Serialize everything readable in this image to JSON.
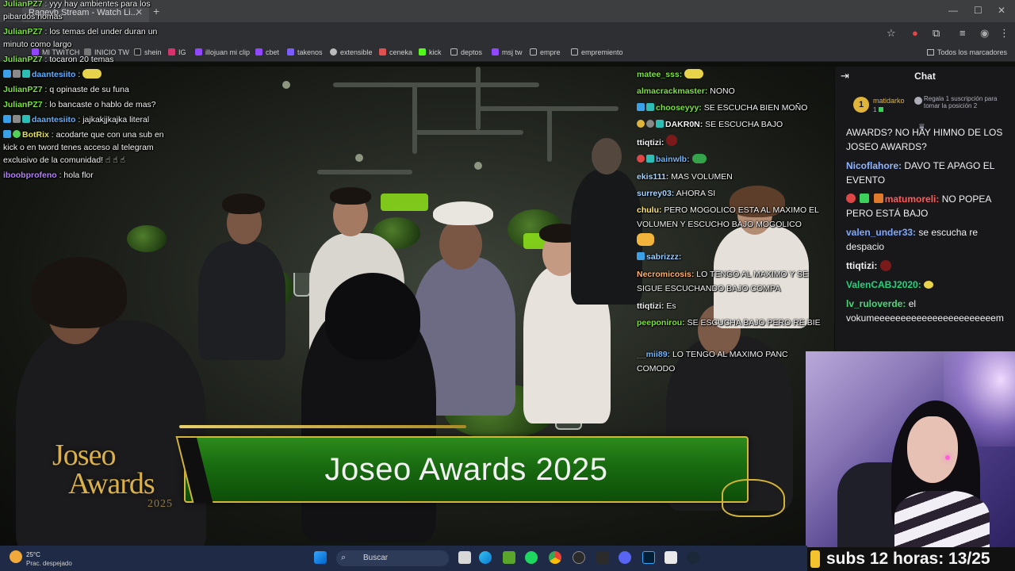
{
  "browser": {
    "tab_title": "Rageyb Stream - Watch Li...",
    "bookmarks": [
      "MI TWITCH",
      "INICIO TW",
      "shein",
      "IG",
      "illojuan mi clip",
      "cbet",
      "takenos",
      "extensible",
      "ceneka",
      "kick",
      "deptos",
      "msj tw",
      "empre",
      "empremiento"
    ],
    "all_bookmarks": "Todos los marcadores"
  },
  "stream": {
    "logo_line1": "Joseo",
    "logo_line2": "Awards",
    "logo_year": "2025",
    "banner_title": "Joseo Awards 2025"
  },
  "overlay_left": [
    {
      "user": "JulianPZ7",
      "text": ": yyy hay ambientes para los"
    },
    {
      "user": "",
      "text": "pibardos nomas"
    },
    {
      "user": "JulianPZ7",
      "text": ": los temas del under duran un"
    },
    {
      "user": "",
      "text": "minuto como largo"
    },
    {
      "user": "JulianPZ7",
      "text": ": tocaron 20 temas"
    },
    {
      "user": "daantesiito",
      "text": ":"
    },
    {
      "user": "JulianPZ7",
      "text": ": q opinaste de su funa"
    },
    {
      "user": "JulianPZ7",
      "text": ": lo bancaste o hablo de mas?"
    },
    {
      "user": "daantesiito",
      "text": ": jajkakjjkajka literal"
    },
    {
      "user": "BotRix",
      "text": ": acodarte que con una sub en"
    },
    {
      "user": "",
      "text": "kick o en tword tenes acceso al telegram"
    },
    {
      "user": "",
      "text": "exclusivo de la comunidad!"
    },
    {
      "user": "iboobprofeno",
      "text": ": hola flor"
    }
  ],
  "overlay_right": [
    {
      "user": "matee_sss:",
      "text": ""
    },
    {
      "user": "almacrackmaster:",
      "text": "NONO"
    },
    {
      "user": "chooseyyy:",
      "text": "SE ESCUCHA BIEN MOÑO"
    },
    {
      "user": "DAKR0N:",
      "text": "SE ESCUCHA BAJO"
    },
    {
      "user": "ttiqtizi:",
      "text": ""
    },
    {
      "user": "bainwlb:",
      "text": ""
    },
    {
      "user": "ekis111:",
      "text": "MAS VOLUMEN"
    },
    {
      "user": "surrey03:",
      "text": "AHORA SI"
    },
    {
      "user": "chulu:",
      "text": "PERO MOGOLICO ESTA AL MAXIMO EL"
    },
    {
      "user": "",
      "text": "VOLUMEN Y ESCUCHO BAJO MOGOLICO"
    },
    {
      "user": "sabrizzz:",
      "text": ""
    },
    {
      "user": "Necromicosis:",
      "text": "LO TENGO AL MAXIMO Y SE"
    },
    {
      "user": "",
      "text": "SIGUE ESCUCHANDO BAJO COMPA"
    },
    {
      "user": "ttiqtizi:",
      "text": "Es"
    },
    {
      "user": "peeponirou:",
      "text": "SE ESCUCHA BAJO PERO RE BIE"
    },
    {
      "user": "__mii89:",
      "text": "LO TENGO AL MAXIMO PANC"
    },
    {
      "user": "",
      "text": "COMODO"
    }
  ],
  "chat_panel": {
    "title": "Chat",
    "gift_user": "matidarko",
    "gift_count": "1",
    "gift_rank": "1",
    "gift_text": "Regala 1 suscripción para tomar la posición 2",
    "messages": [
      {
        "user": "",
        "text": "AWARDS? NO HAY HIMNO DE LOS JOSEO AWARDS?",
        "color": "#efeff1"
      },
      {
        "user": "Nicoflahore:",
        "text": "DAVO TE APAGO EL EVENTO",
        "color": "#8fb4ff"
      },
      {
        "user": "matumoreli:",
        "text": "NO POPEA PERO ESTÁ BAJO",
        "color": "#ff5a5a"
      },
      {
        "user": "valen_under33:",
        "text": "se escucha re despacio",
        "color": "#7fa8ff"
      },
      {
        "user": "ttiqtizi:",
        "text": "",
        "color": "#efeff1"
      },
      {
        "user": "ValenCABJ2020:",
        "text": "",
        "color": "#22d27a"
      },
      {
        "user": "lv_ruloverde:",
        "text": "el vokumeeeeeeeeeeeeeeeeeeeeeeem",
        "color": "#4fd67b"
      }
    ]
  },
  "subs_bar": "subs 12 horas: 13/25",
  "taskbar": {
    "temp": "25°C",
    "weather": "Prac. despejado",
    "search": "Buscar"
  },
  "colors": {
    "banner_green": "#186b10",
    "gold": "#d4b53a",
    "chat_bg": "#18181b"
  }
}
